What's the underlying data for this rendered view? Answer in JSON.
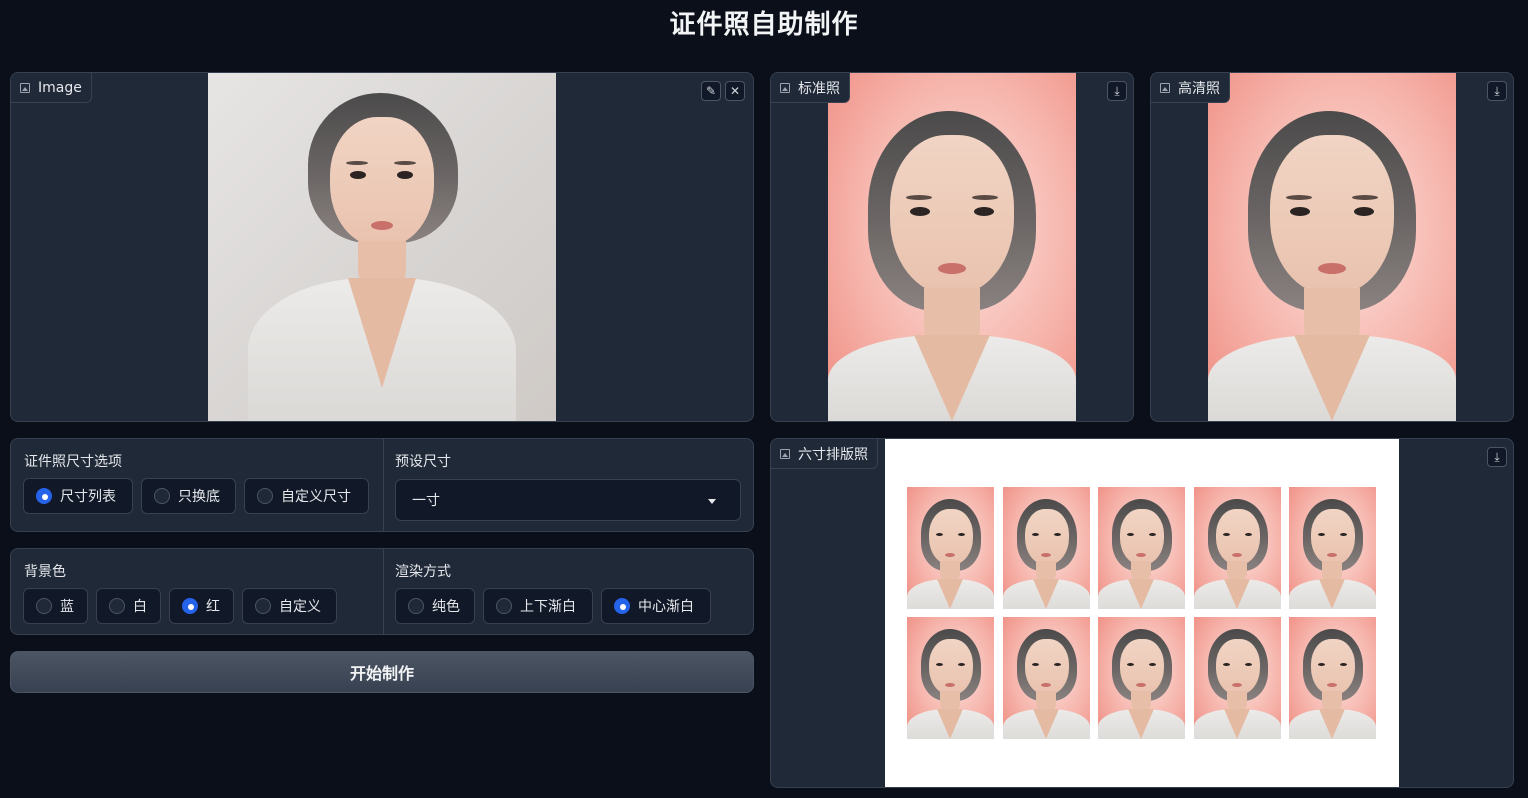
{
  "page": {
    "title": "证件照自助制作"
  },
  "input_panel": {
    "label": "Image",
    "edit_icon": "pencil-icon",
    "clear_icon": "close-icon"
  },
  "output_standard": {
    "label": "标准照",
    "download_icon": "download-icon"
  },
  "output_hd": {
    "label": "高清照",
    "download_icon": "download-icon"
  },
  "output_layout": {
    "label": "六寸排版照",
    "download_icon": "download-icon",
    "rows": 2,
    "columns": 5
  },
  "size_options": {
    "label": "证件照尺寸选项",
    "options": [
      "尺寸列表",
      "只换底",
      "自定义尺寸"
    ],
    "selected": "尺寸列表"
  },
  "preset_size": {
    "label": "预设尺寸",
    "value": "一寸"
  },
  "background_color": {
    "label": "背景色",
    "options": [
      "蓝",
      "白",
      "红",
      "自定义"
    ],
    "selected": "红"
  },
  "render_mode": {
    "label": "渲染方式",
    "options": [
      "纯色",
      "上下渐白",
      "中心渐白"
    ],
    "selected": "中心渐白"
  },
  "start_button": {
    "label": "开始制作"
  },
  "colors": {
    "page_bg": "#0b0f19",
    "panel_bg": "#1f2937",
    "accent": "#2563eb",
    "photo_bg_red": "#ef8a80"
  }
}
